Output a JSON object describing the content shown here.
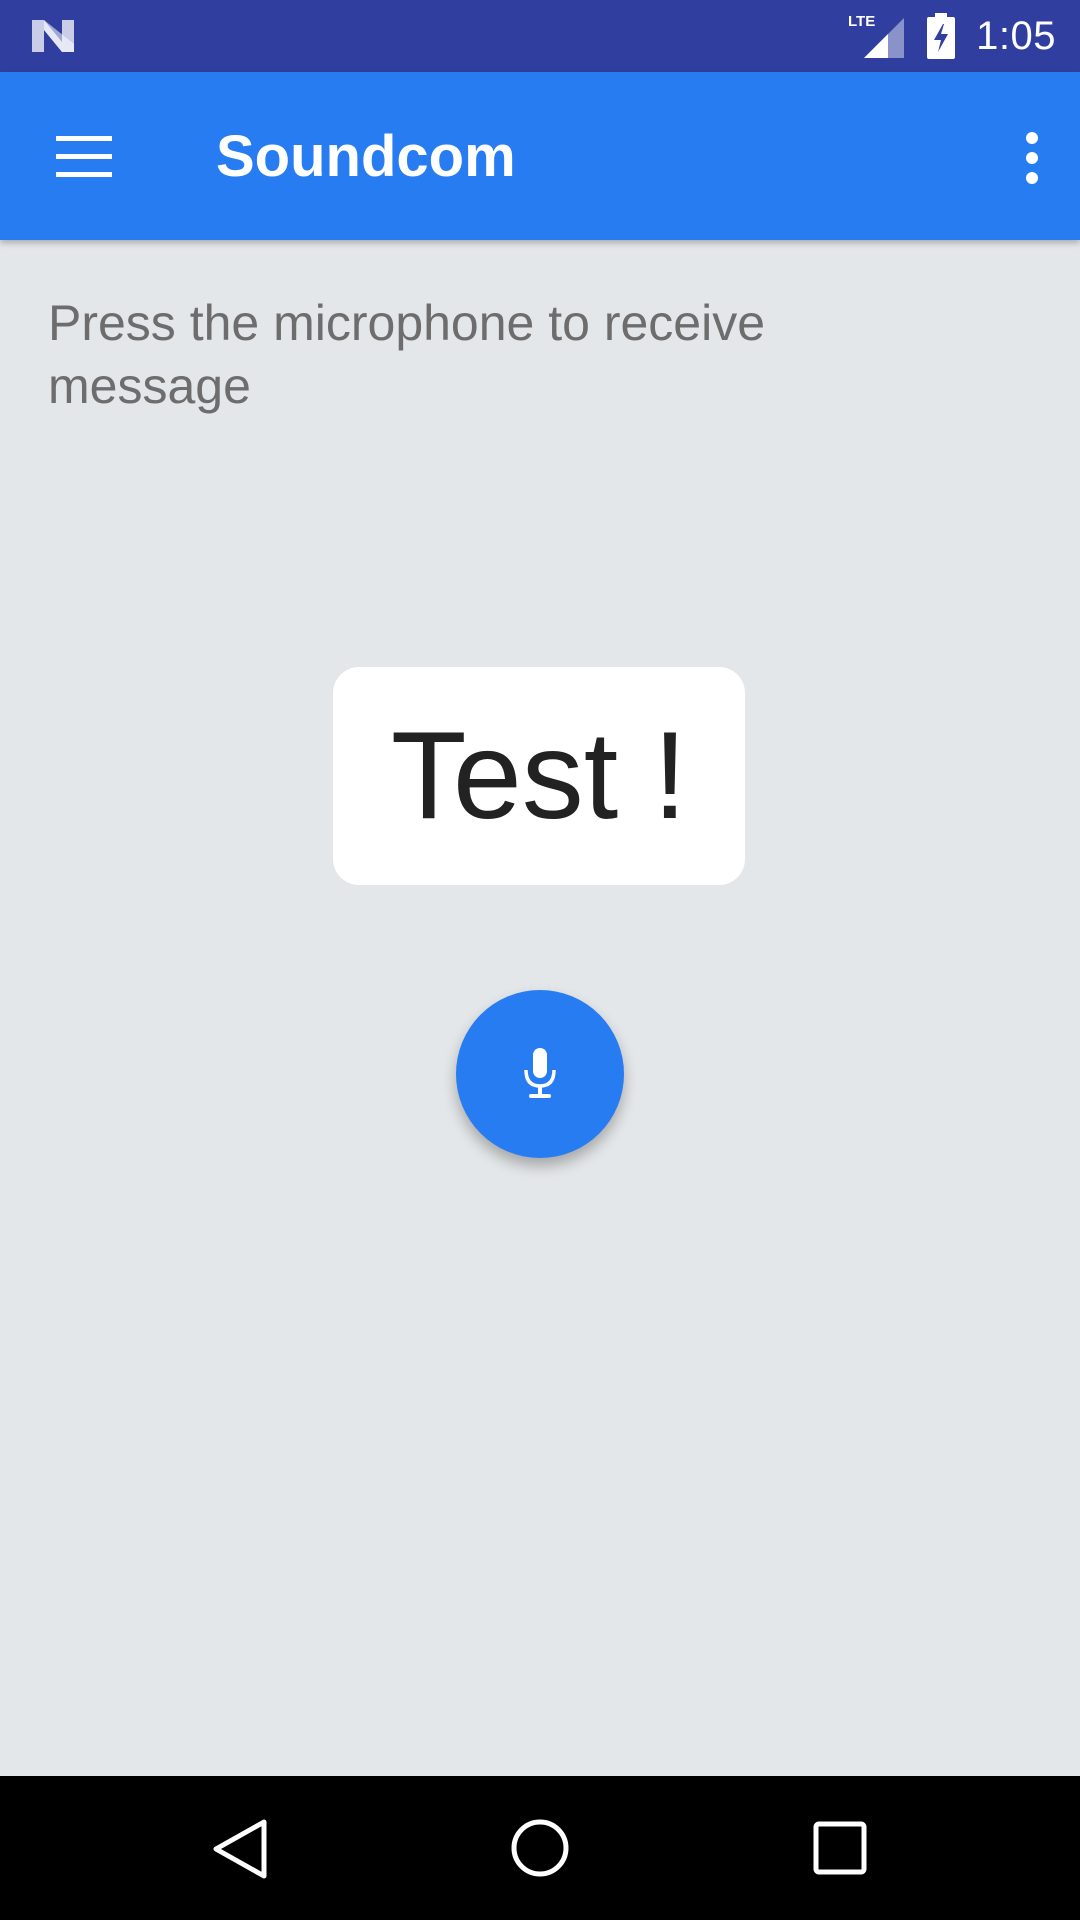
{
  "status_bar": {
    "network_label": "LTE",
    "time": "1:05",
    "background": "#303f9f",
    "icons": [
      "notification-n-icon",
      "lte-signal-icon",
      "battery-charging-icon"
    ]
  },
  "app_bar": {
    "title": "Soundcom",
    "background": "#277cf2",
    "icons": [
      "hamburger-menu-icon",
      "more-vertical-icon"
    ]
  },
  "content": {
    "instruction": "Press the microphone to receive message",
    "message": "Test !",
    "background": "#e4e7e9"
  },
  "mic_button": {
    "icon": "microphone-icon",
    "color": "#277cf2"
  },
  "nav_bar": {
    "icons": [
      "back-icon",
      "home-icon",
      "recents-icon"
    ]
  }
}
